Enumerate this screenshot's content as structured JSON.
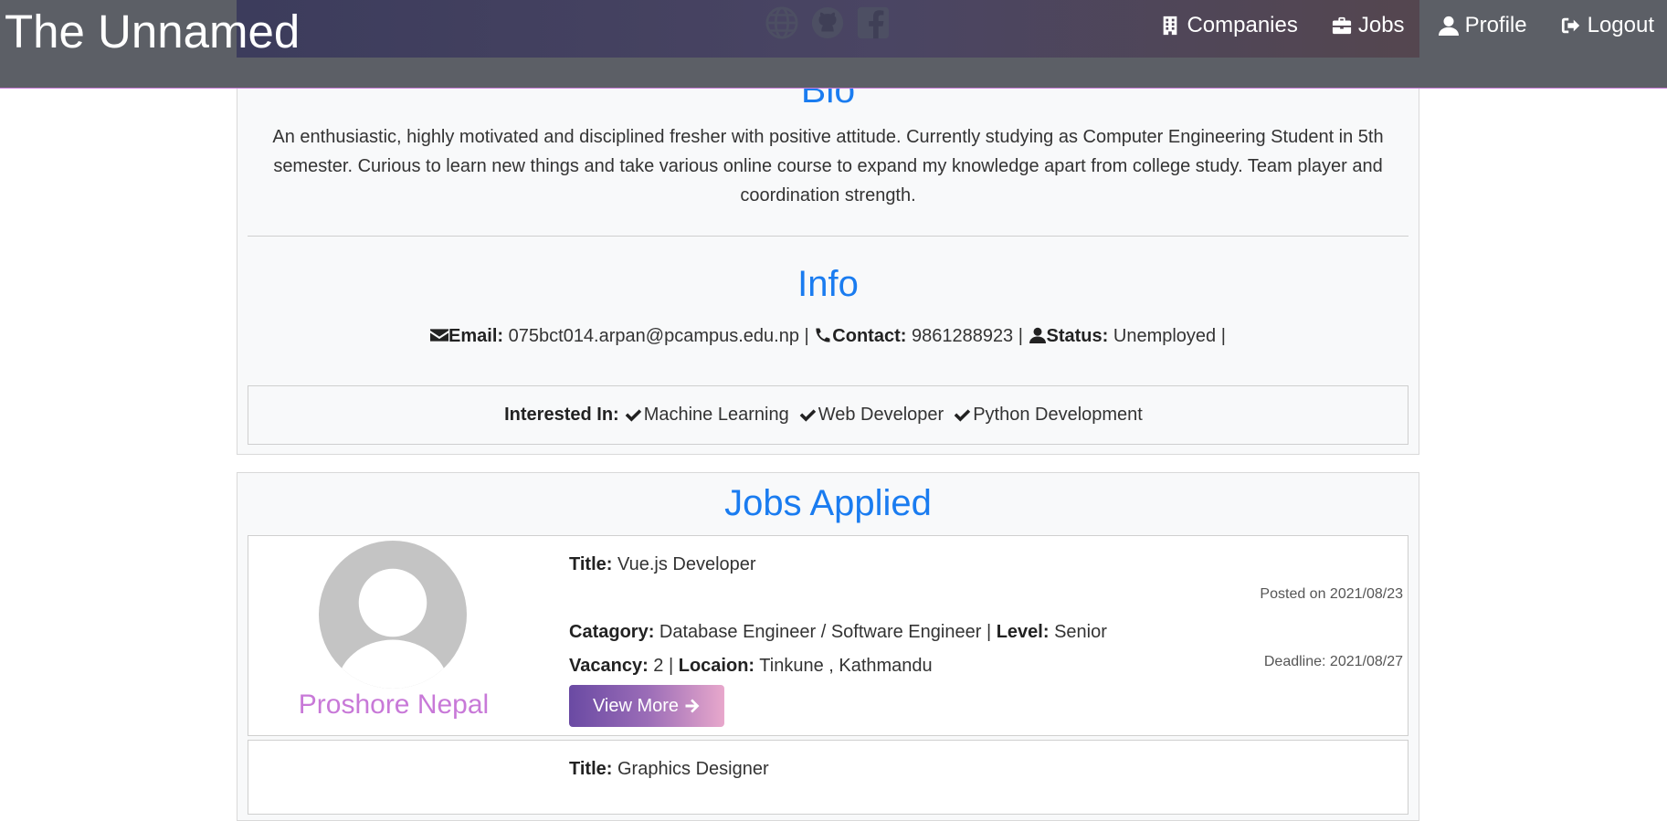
{
  "brand": "The Unnamed",
  "nav": {
    "links": [
      {
        "label": "Companies",
        "icon": "building-icon"
      },
      {
        "label": "Jobs",
        "icon": "briefcase-icon"
      },
      {
        "label": "Profile",
        "icon": "user-icon"
      },
      {
        "label": "Logout",
        "icon": "logout-icon"
      }
    ],
    "social_icons": [
      "globe-icon",
      "github-icon",
      "facebook-icon"
    ]
  },
  "bio": {
    "title": "Bio",
    "text": "An enthusiastic, highly motivated and disciplined fresher with positive attitude. Currently studying as Computer Engineering Student in 5th semester. Curious to learn new things and take various online course to expand my knowledge apart from college study. Team player and coordination strength."
  },
  "info": {
    "title": "Info",
    "email_label": "Email:",
    "email": "075bct014.arpan@pcampus.edu.np",
    "contact_label": "Contact:",
    "contact": "9861288923",
    "status_label": "Status:",
    "status": "Unemployed",
    "separator": "|",
    "interested_label": "Interested In:",
    "interests": [
      "Machine Learning",
      "Web Developer",
      "Python Development"
    ]
  },
  "jobs": {
    "title": "Jobs Applied",
    "items": [
      {
        "company": "Proshore Nepal",
        "title_label": "Title:",
        "title": "Vue.js Developer",
        "posted": "Posted on 2021/08/23",
        "category_label": "Catagory:",
        "category": "Database Engineer / Software Engineer",
        "level_label": "Level:",
        "level": "Senior",
        "vacancy_label": "Vacancy:",
        "vacancy": "2",
        "location_label": "Locaion:",
        "location": "Tinkune , Kathmandu",
        "deadline": "Deadline: 2021/08/27",
        "button": "View More"
      },
      {
        "title_label": "Title:",
        "title": "Graphics Designer"
      }
    ]
  },
  "colors": {
    "accent_blue": "#1a7cf0",
    "company_pink": "#c879d8",
    "nav_bg": "#5c5f66"
  }
}
